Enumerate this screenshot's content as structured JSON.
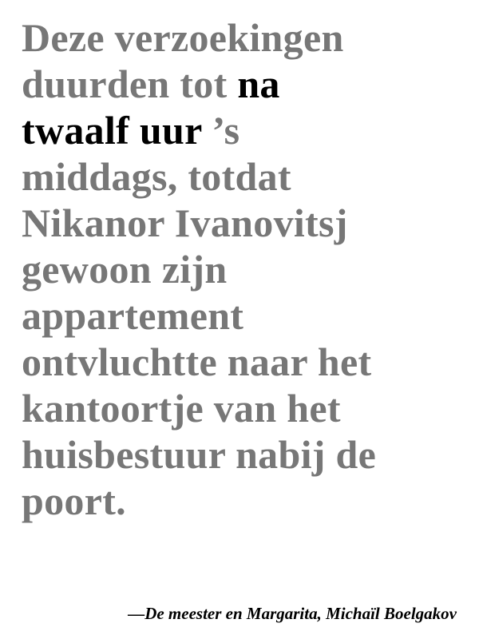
{
  "quote": {
    "lines": [
      {
        "before": "Deze verzoekingen",
        "highlight": "",
        "after": ""
      },
      {
        "before": "duurden tot ",
        "highlight": "na",
        "after": ""
      },
      {
        "before": "",
        "highlight": "twaalf uur",
        "after": " ’s"
      },
      {
        "before": "middags, totdat",
        "highlight": "",
        "after": ""
      },
      {
        "before": "Nikanor Ivanovitsj",
        "highlight": "",
        "after": ""
      },
      {
        "before": "gewoon zijn",
        "highlight": "",
        "after": ""
      },
      {
        "before": "appartement",
        "highlight": "",
        "after": ""
      },
      {
        "before": "ontvluchtte naar het",
        "highlight": "",
        "after": ""
      },
      {
        "before": "kantoortje van het",
        "highlight": "",
        "after": ""
      },
      {
        "before": "huisbestuur nabij de",
        "highlight": "",
        "after": ""
      },
      {
        "before": "poort.",
        "highlight": "",
        "after": ""
      }
    ]
  },
  "attribution": "—De meester en Margarita, Michaïl Boelgakov",
  "colors": {
    "text": "#777777",
    "highlight": "#000000"
  }
}
